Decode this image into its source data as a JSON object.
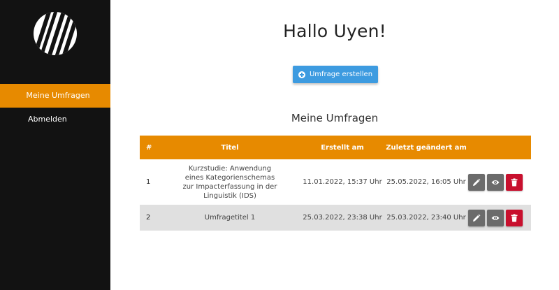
{
  "sidebar": {
    "logo_alt": "UW",
    "nav": [
      {
        "label": "Meine Umfragen",
        "active": true
      },
      {
        "label": "Abmelden",
        "active": false
      }
    ],
    "active_color": "#e78a00",
    "bg_color": "#121212"
  },
  "main": {
    "greeting": "Hallo Uyen!",
    "create_button": {
      "label": "Umfrage erstellen",
      "icon": "plus-circle-icon"
    },
    "section_title": "Meine Umfragen",
    "table": {
      "columns": [
        "#",
        "Titel",
        "Erstellt am",
        "Zuletzt geändert am"
      ],
      "rows": [
        {
          "num": "1",
          "title": "Kurzstudie: Anwendung eines Kategorienschemas zur Impacterfassung in der Linguistik (IDS)",
          "created": "11.01.2022, 15:37 Uhr",
          "changed": "25.05.2022, 16:05 Uhr"
        },
        {
          "num": "2",
          "title": "Umfragetitel 1",
          "created": "25.03.2022, 23:38 Uhr",
          "changed": "25.03.2022, 23:40 Uhr"
        }
      ],
      "actions": [
        "edit-icon",
        "eye-icon",
        "trash-icon"
      ]
    }
  },
  "colors": {
    "header": "#e78a00",
    "button": "#3d9be0",
    "delete": "#c8102e",
    "grey_action": "#6b6b6b"
  }
}
